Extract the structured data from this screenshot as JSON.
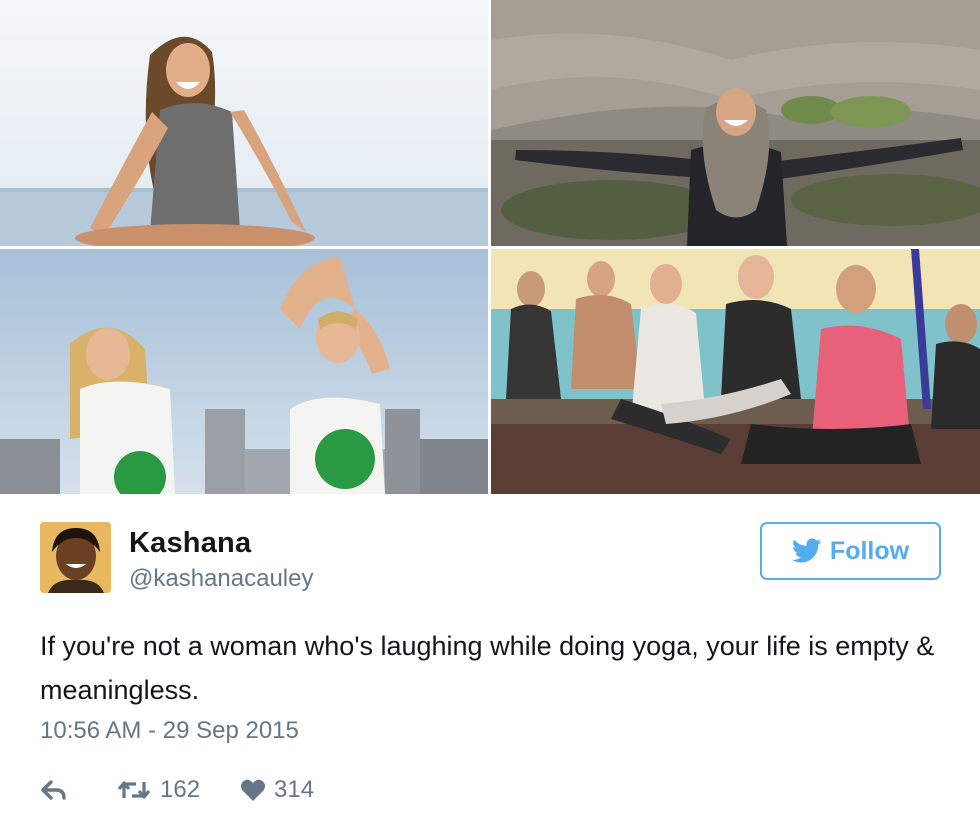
{
  "photos": [
    {
      "name": "photo-woman-laughing-beach"
    },
    {
      "name": "photo-woman-laughing-rocks"
    },
    {
      "name": "photo-two-women-laughing-city"
    },
    {
      "name": "photo-group-laughing-yoga-class"
    }
  ],
  "user": {
    "display_name": "Kashana",
    "handle": "@kashanacauley"
  },
  "follow": {
    "label": "Follow",
    "icon": "twitter-bird-icon",
    "color": "#55acee"
  },
  "tweet": {
    "text": "If you're not a woman who's laughing while doing yoga, your life is empty & meaningless.",
    "timestamp": "10:56 AM - 29 Sep 2015"
  },
  "actions": {
    "reply_icon": "reply-icon",
    "retweet_icon": "retweet-icon",
    "retweet_count": "162",
    "like_icon": "heart-icon",
    "like_count": "314"
  },
  "colors": {
    "text": "#14171a",
    "secondary": "#657786",
    "accent": "#55acee"
  }
}
